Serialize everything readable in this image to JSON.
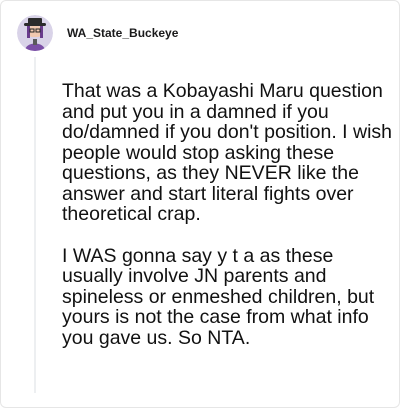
{
  "comment": {
    "author": "WA_State_Buckeye",
    "paragraphs": [
      "That was a Kobayashi Maru question and put you in a damned if you do/damned if you don't position. I wish people would stop asking these questions, as they NEVER like the answer and start literal fights over theoretical crap.",
      "I WAS gonna say y t a as these usually involve JN parents and spineless or enmeshed children, but yours is not the case from what info you gave us. So NTA."
    ]
  },
  "icons": {
    "avatar": "user-avatar-icon"
  },
  "colors": {
    "text": "#111111",
    "username": "#1a1a1b",
    "thread_line": "#edeff1"
  }
}
